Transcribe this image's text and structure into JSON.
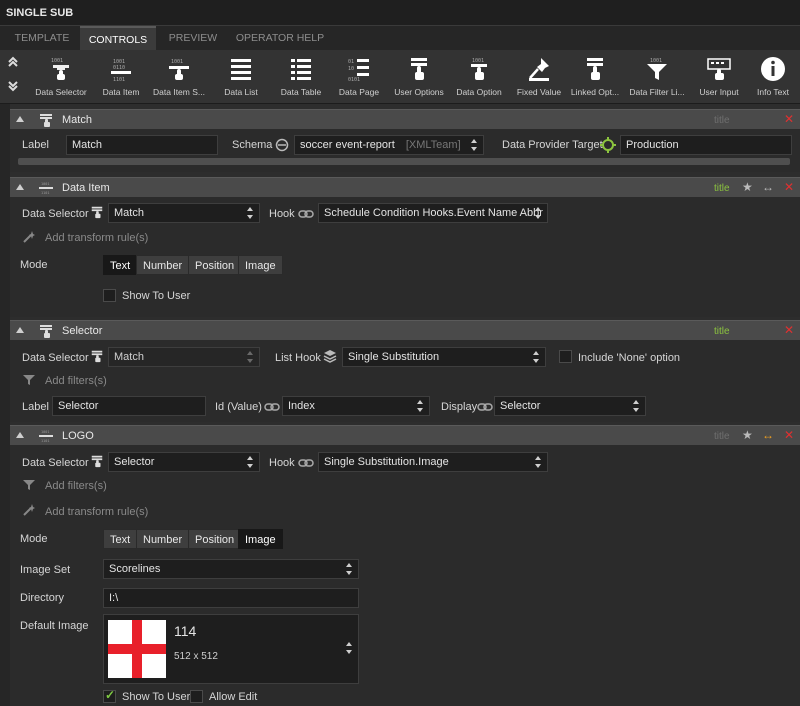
{
  "window": {
    "title": "SINGLE SUB"
  },
  "tabs": [
    {
      "label": "TEMPLATE"
    },
    {
      "label": "CONTROLS"
    },
    {
      "label": "PREVIEW"
    },
    {
      "label": "OPERATOR HELP"
    }
  ],
  "toolbar": {
    "items": [
      {
        "label": "Data Selector",
        "icon": "data-selector-icon"
      },
      {
        "label": "Data Item",
        "icon": "data-item-icon"
      },
      {
        "label": "Data Item S...",
        "icon": "data-item-s-icon"
      },
      {
        "label": "Data List",
        "icon": "data-list-icon"
      },
      {
        "label": "Data Table",
        "icon": "data-table-icon"
      },
      {
        "label": "Data Page",
        "icon": "data-page-icon"
      },
      {
        "label": "User Options",
        "icon": "user-options-icon"
      },
      {
        "label": "Data Option",
        "icon": "data-option-icon"
      },
      {
        "label": "Fixed Value",
        "icon": "pin-icon"
      },
      {
        "label": "Linked Opt...",
        "icon": "linked-options-icon"
      },
      {
        "label": "Data Filter Li...",
        "icon": "filter-icon"
      },
      {
        "label": "User Input",
        "icon": "keyboard-icon"
      },
      {
        "label": "Info Text",
        "icon": "info-icon"
      }
    ]
  },
  "panels": {
    "match": {
      "title": "Match",
      "tag": "title",
      "label_caption": "Label",
      "label_value": "Match",
      "schema_caption": "Schema",
      "schema_value": "soccer event-report",
      "schema_sub": "[XMLTeam]",
      "target_caption": "Data Provider Target",
      "target_value": "Production"
    },
    "data_item": {
      "title": "Data Item",
      "tag": "title",
      "selector_caption": "Data Selector",
      "selector_value": "Match",
      "hook_caption": "Hook",
      "hook_value": "Schedule Condition Hooks.Event Name Abbr",
      "transform": "Add transform rule(s)",
      "mode_caption": "Mode",
      "modes": [
        "Text",
        "Number",
        "Position",
        "Image"
      ],
      "show_user": "Show To User"
    },
    "selector": {
      "title": "Selector",
      "tag": "title",
      "selector_caption": "Data Selector",
      "selector_value": "Match",
      "listhook_caption": "List Hook",
      "listhook_value": "Single Substitution",
      "include_none": "Include 'None' option",
      "filters": "Add filters(s)",
      "label_caption": "Label",
      "label_value": "Selector",
      "id_caption": "Id (Value)",
      "id_value": "Index",
      "display_caption": "Display",
      "display_value": "Selector"
    },
    "logo": {
      "title": "LOGO",
      "tag": "title",
      "selector_caption": "Data Selector",
      "selector_value": "Selector",
      "hook_caption": "Hook",
      "hook_value": "Single Substitution.Image",
      "filters": "Add filters(s)",
      "transform": "Add transform rule(s)",
      "mode_caption": "Mode",
      "modes": [
        "Text",
        "Number",
        "Position",
        "Image"
      ],
      "imageset_caption": "Image Set",
      "imageset_value": "Scorelines",
      "directory_caption": "Directory",
      "directory_value": "I:\\",
      "default_caption": "Default Image",
      "default_name": "114",
      "default_size": "512 x 512",
      "show_user": "Show To User",
      "allow_edit": "Allow Edit"
    }
  },
  "colors": {
    "accent_green": "#8cc43f",
    "close_red": "#e03030",
    "link_orange": "#f0a020"
  }
}
